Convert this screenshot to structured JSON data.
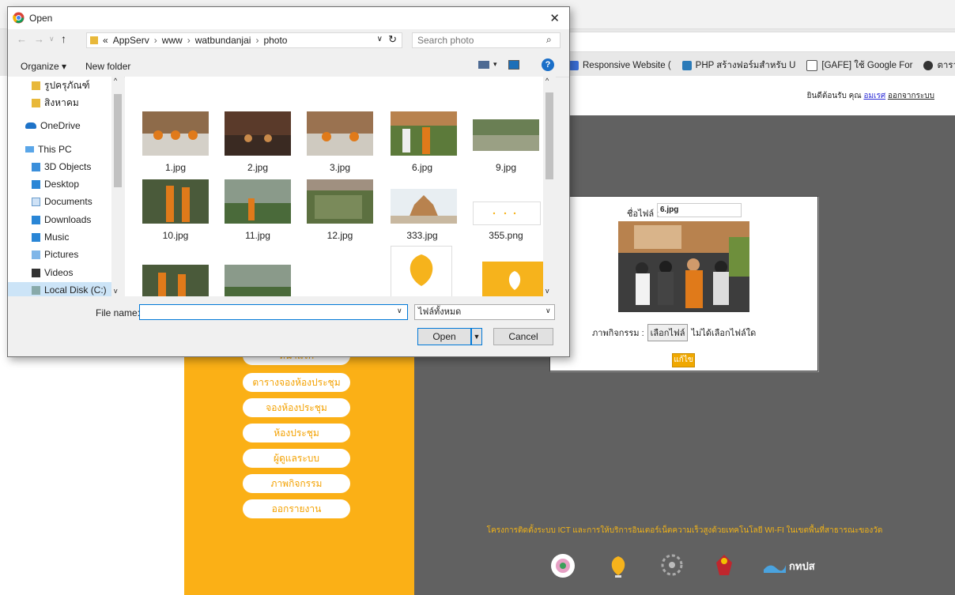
{
  "browser": {
    "bookmarks": [
      {
        "label": "Responsive Website ("
      },
      {
        "label": "PHP สร้างฟอร์มสำหรับ U"
      },
      {
        "label": "[GAFE] ใช้ Google For"
      },
      {
        "label": "ตารางนิ"
      }
    ]
  },
  "page": {
    "welcome_prefix": "ยินดีต้อนรับ คุณ",
    "user": "อมเรศ",
    "logout": "ออกจากระบบ",
    "nav": [
      "หน้าแรก",
      "ตารางจองห้องประชุม",
      "จองห้องประชุม",
      "ห้องประชุม",
      "ผู้ดูแลระบบ",
      "ภาพกิจกรรม",
      "ออกรายงาน"
    ],
    "form": {
      "file_label": "ชื่อไฟล์ :",
      "file_value": "6.jpg",
      "activity_label": "ภาพกิจกรรม :",
      "choose_button": "เลือกไฟล์",
      "no_file": "ไม่ได้เลือกไฟล์ใด",
      "submit": "แก้ไข"
    },
    "footer_text": "โครงการติดตั้งระบบ ICT และการให้บริการอินเตอร์เน็ตความเร็วสูงด้วยเทคโนโลยี WI-FI ในเขตพื้นที่สาธารณะของวัด",
    "footer_logo_text": "กทปส"
  },
  "dialog": {
    "title": "Open",
    "breadcrumb": [
      "«",
      "AppServ",
      "www",
      "watbundanjai",
      "photo"
    ],
    "search_placeholder": "Search photo",
    "organize": "Organize ▾",
    "new_folder": "New folder",
    "nav_items": [
      {
        "label": "รูปครุภัณฑ์",
        "icon": "folder-icon"
      },
      {
        "label": "สิงหาคม",
        "icon": "folder-icon"
      },
      {
        "label": "OneDrive",
        "icon": "cloud-icon"
      },
      {
        "label": "This PC",
        "icon": "computer-icon"
      },
      {
        "label": "3D Objects",
        "icon": "3d-objects-icon"
      },
      {
        "label": "Desktop",
        "icon": "desktop-icon"
      },
      {
        "label": "Documents",
        "icon": "documents-icon"
      },
      {
        "label": "Downloads",
        "icon": "downloads-icon"
      },
      {
        "label": "Music",
        "icon": "music-icon"
      },
      {
        "label": "Pictures",
        "icon": "pictures-icon"
      },
      {
        "label": "Videos",
        "icon": "videos-icon"
      },
      {
        "label": "Local Disk (C:)",
        "icon": "drive-icon"
      }
    ],
    "files": [
      {
        "name": "1.jpg"
      },
      {
        "name": "2.jpg"
      },
      {
        "name": "3.jpg"
      },
      {
        "name": "6.jpg"
      },
      {
        "name": "9.jpg"
      },
      {
        "name": "10.jpg"
      },
      {
        "name": "11.jpg"
      },
      {
        "name": "12.jpg"
      },
      {
        "name": "333.jpg"
      },
      {
        "name": "355.png"
      }
    ],
    "file_name_label": "File name:",
    "file_name_value": "",
    "file_type": "ไฟล์ทั้งหมด",
    "open_button": "Open",
    "cancel_button": "Cancel"
  }
}
